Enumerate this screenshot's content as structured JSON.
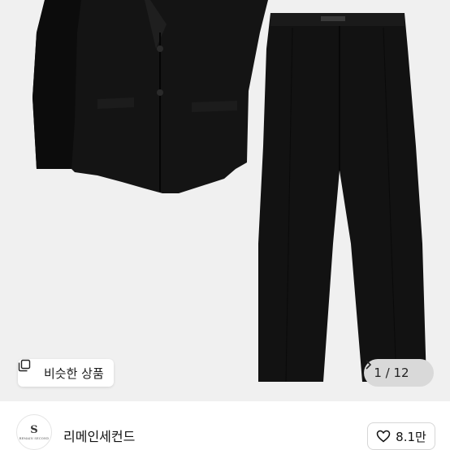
{
  "gallery": {
    "similar_label": "비슷한 상품",
    "similar_icon": "similar-items-icon",
    "current": "1",
    "total": "12",
    "counter_text": "1 / 12",
    "next_icon": "chevron-right-icon"
  },
  "shop": {
    "name": "리메인세컨드",
    "logo_mark": "S",
    "logo_text": "REMAIN SECOND",
    "likes": "8.1만",
    "like_icon": "heart-icon"
  },
  "colors": {
    "photo_bg": "#f0f0f0",
    "garment": "#131313",
    "counter_bg": "#d9d9d9"
  }
}
